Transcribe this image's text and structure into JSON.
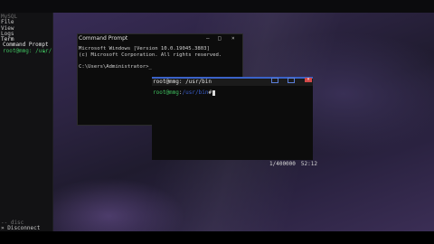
{
  "sidebar": {
    "lines": [
      "MySQL",
      "File",
      "View",
      "Logs",
      "Term",
      "Command Prompt",
      "root@mmg: /usr/"
    ],
    "footer_hint": "-- disc",
    "footer_disconnect": "» Disconnect",
    "chevron": "<"
  },
  "cmd_window": {
    "title": "Command Prompt",
    "lines": [
      "Microsoft Windows [Version 10.0.19045.3803]",
      "(c) Microsoft Corporation. All rights reserved.",
      "",
      "C:\\Users\\Administrator>_"
    ],
    "controls": [
      "–",
      "□",
      "×"
    ]
  },
  "ssh_window": {
    "title": "root@mmg: /usr/bin",
    "prompt_user": "root@mmg",
    "prompt_sep": ":",
    "prompt_path": "/usr/bin",
    "prompt_end": "#",
    "controls": [
      "–",
      "□",
      "×"
    ]
  },
  "status": {
    "position": "1/400000",
    "time": "52:12"
  },
  "colors": {
    "prompt_green": "#3fbf5f",
    "path_blue": "#3a5fcf",
    "titlebar_accent": "#3a62c8",
    "close_red": "#d24848"
  }
}
